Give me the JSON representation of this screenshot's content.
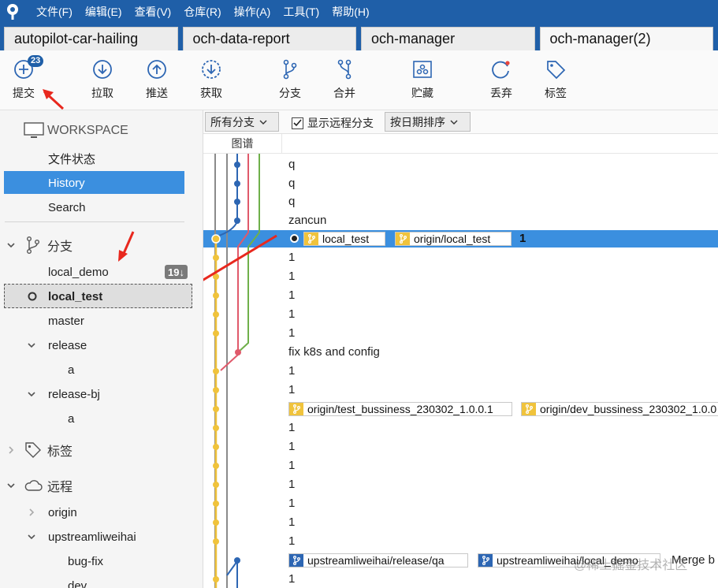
{
  "menubar": {
    "items": [
      "文件(F)",
      "编辑(E)",
      "查看(V)",
      "仓库(R)",
      "操作(A)",
      "工具(T)",
      "帮助(H)"
    ]
  },
  "repo_tabs": [
    "autopilot-car-hailing",
    "och-data-report",
    "och-manager",
    "och-manager(2)"
  ],
  "toolbar": {
    "commit": {
      "label": "提交",
      "badge": "23"
    },
    "pull": {
      "label": "拉取"
    },
    "push": {
      "label": "推送"
    },
    "fetch": {
      "label": "获取"
    },
    "branch": {
      "label": "分支"
    },
    "merge": {
      "label": "合并"
    },
    "stash": {
      "label": "贮藏"
    },
    "discard": {
      "label": "丢弃"
    },
    "tag": {
      "label": "标签"
    }
  },
  "sidebar": {
    "workspace": {
      "title": "WORKSPACE",
      "items": [
        "文件状态",
        "History",
        "Search"
      ]
    },
    "branches": {
      "title": "分支",
      "local_demo": {
        "label": "local_demo",
        "badge": "19↓"
      },
      "local_test": {
        "label": "local_test"
      },
      "master": {
        "label": "master"
      },
      "release": {
        "label": "release",
        "child": "a"
      },
      "release_bj": {
        "label": "release-bj",
        "child": "a"
      }
    },
    "tags": {
      "title": "标签"
    },
    "remotes": {
      "title": "远程",
      "origin": "origin",
      "upstream": "upstreamliweihai",
      "upstream_children": [
        "bug-fix",
        "dev"
      ]
    }
  },
  "filter": {
    "all_branches": "所有分支",
    "show_remote": "显示远程分支",
    "sort": "按日期排序"
  },
  "columns": {
    "graph": "图谱"
  },
  "commits": {
    "messages": [
      "q",
      "q",
      "q",
      "zancun",
      "",
      "1",
      "1",
      "1",
      "1",
      "1",
      "fix k8s and config",
      "1",
      "1",
      "",
      "1",
      "1",
      "1",
      "1",
      "1",
      "1",
      "1",
      "",
      "1"
    ],
    "selected_message": "1",
    "refs": {
      "local_test": "local_test",
      "origin_local_test": "origin/local_test",
      "origin_test_bussiness": "origin/test_bussiness_230302_1.0.0.1",
      "origin_dev_bussiness": "origin/dev_bussiness_230302_1.0.0",
      "upstream_release_qa": "upstreamliweihai/release/qa",
      "upstream_local_demo": "upstreamliweihai/local_demo",
      "merge_text": "Merge b"
    }
  },
  "watermark": "@稀土掘金技术社区",
  "colors": {
    "menubar": "#1f5fa8",
    "selection": "#3b8fdf",
    "lane_yellow": "#f0c33c",
    "lane_blue": "#2d66b3",
    "lane_red": "#e05a6b",
    "lane_green": "#6fb04a",
    "lane_grey": "#8a8a8a"
  }
}
